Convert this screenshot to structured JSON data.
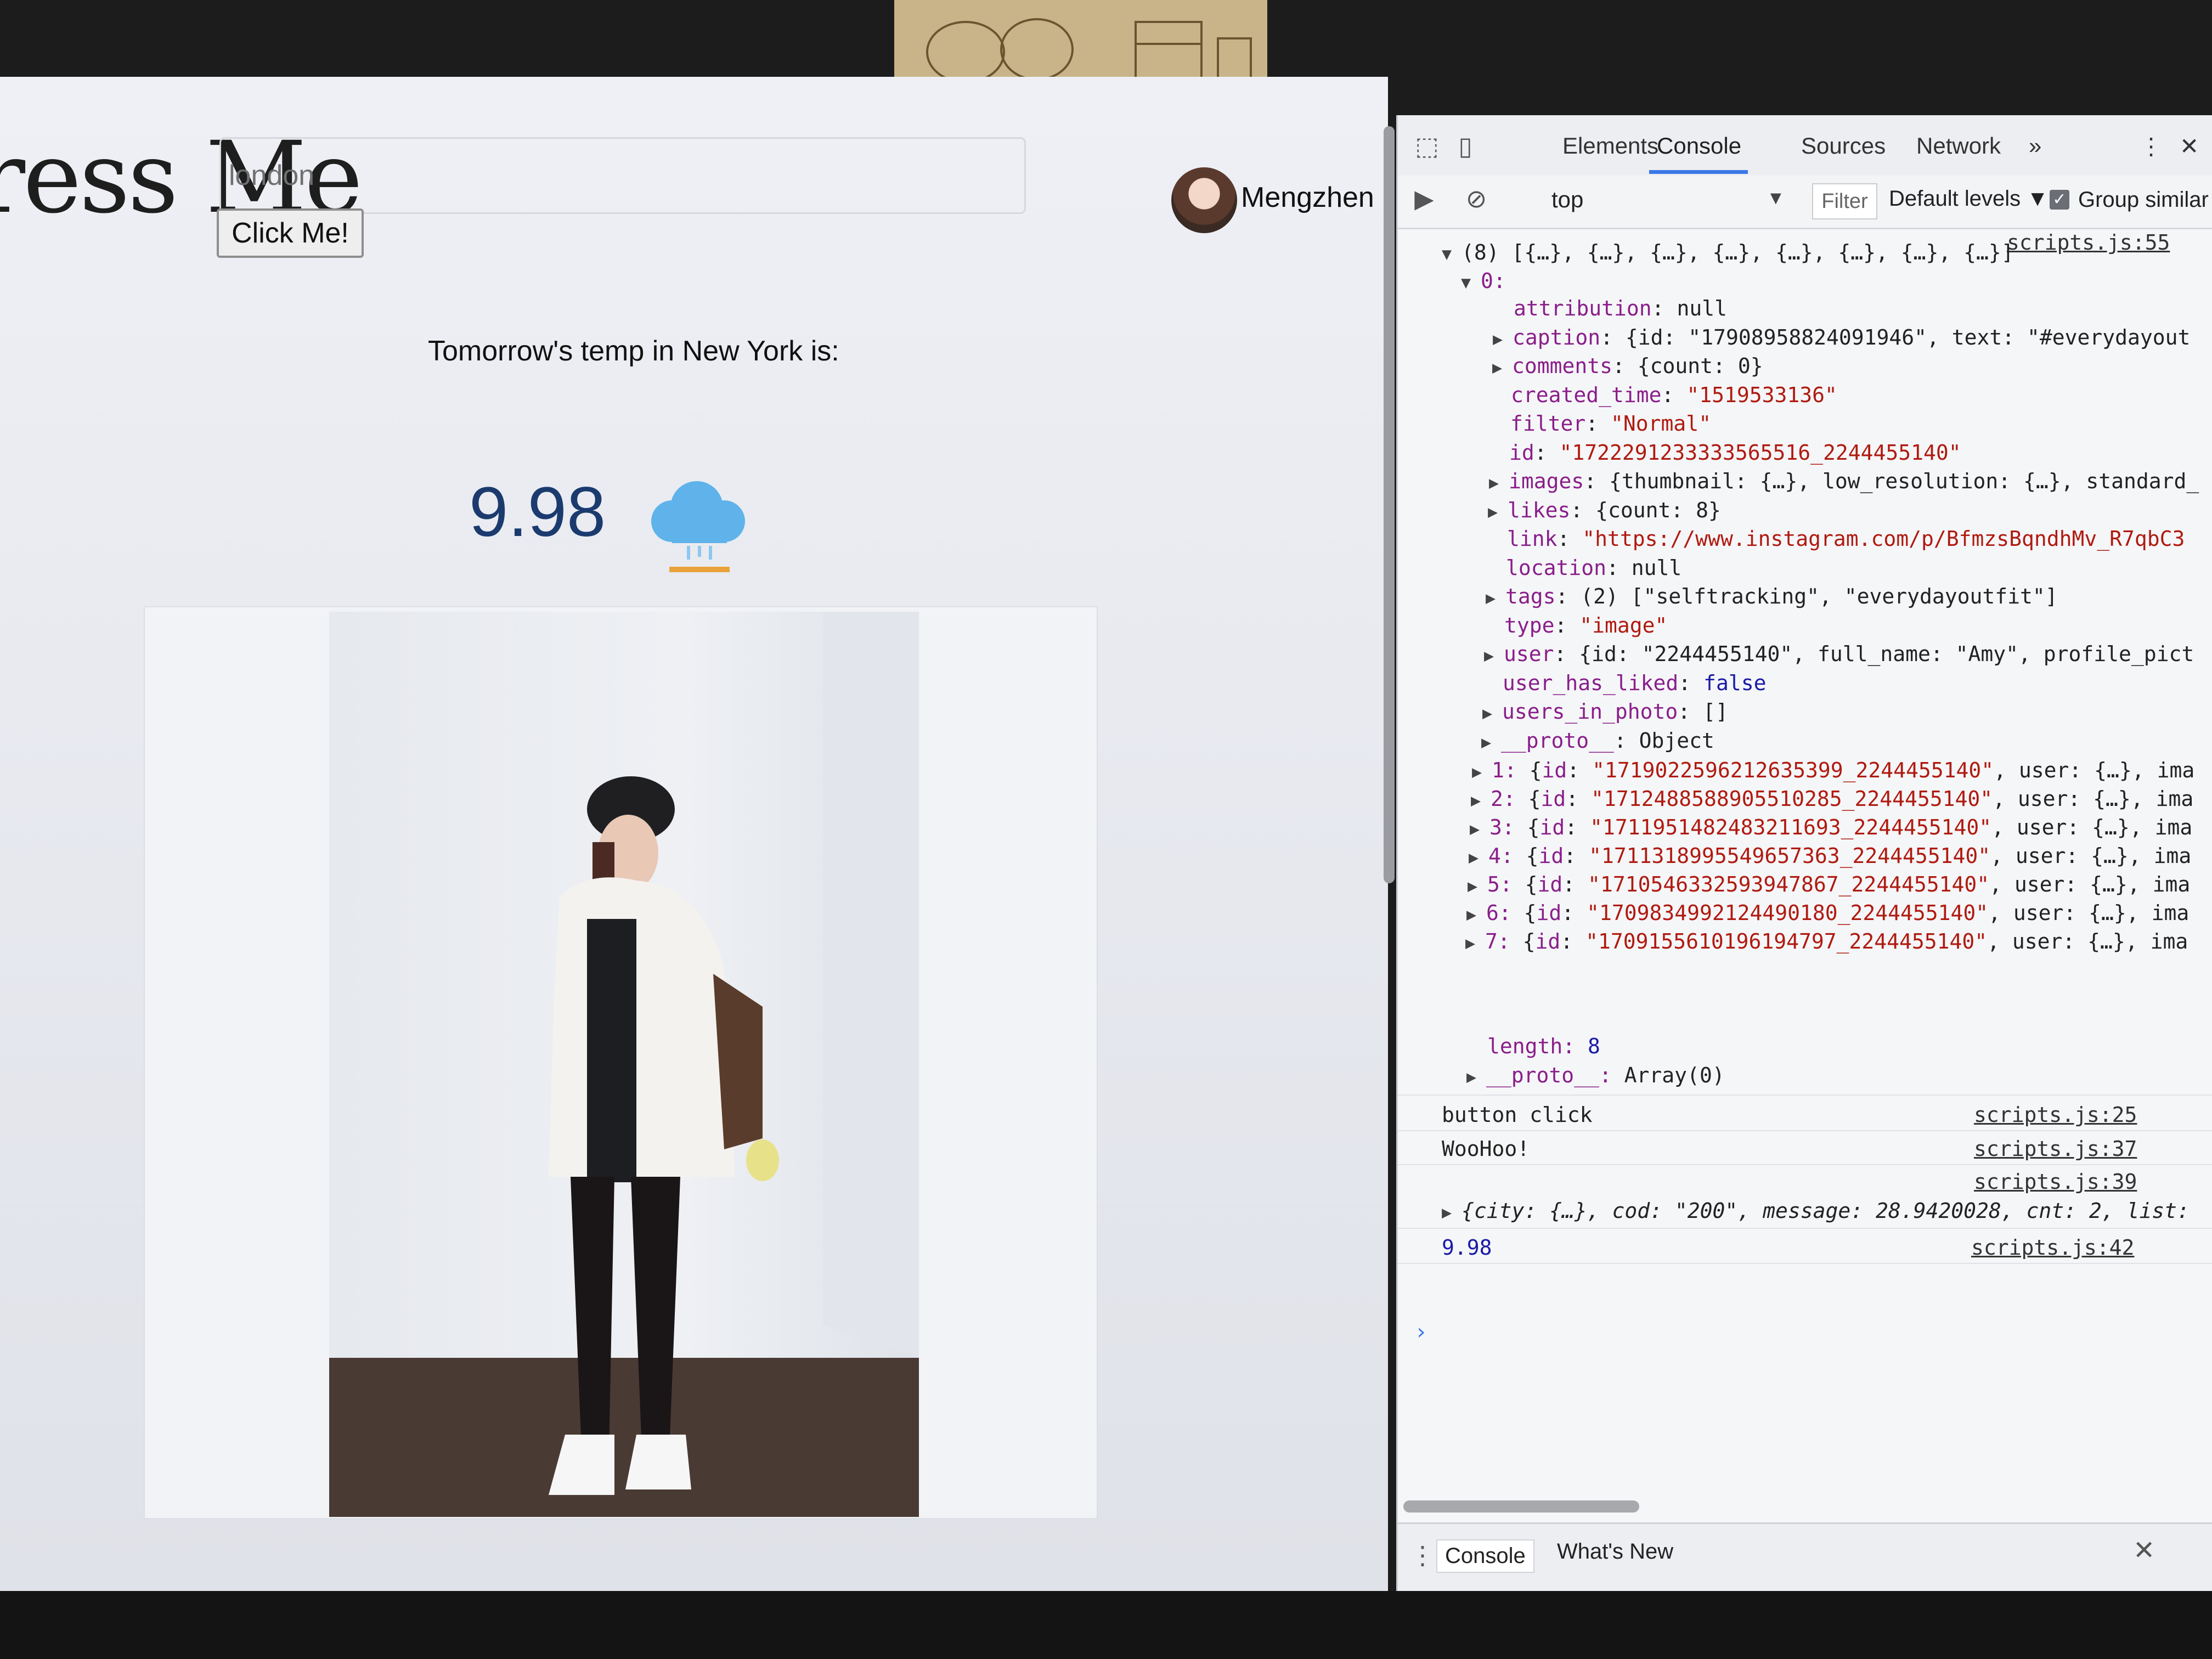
{
  "page": {
    "brand_text": "ress Me",
    "search": {
      "value": "",
      "placeholder": "london"
    },
    "button_label": "Click Me!",
    "user": {
      "name": "Mengzhen"
    },
    "forecast": {
      "caption": "Tomorrow's temp in New York is:",
      "temp": "9.98",
      "icon": "rain-cloud-icon"
    }
  },
  "devtools": {
    "tabs": [
      "Elements",
      "Console",
      "Sources",
      "Network",
      "»"
    ],
    "active_tab": "Console",
    "toolbar": {
      "context": "top",
      "filter_placeholder": "Filter",
      "levels": "Default levels ▼",
      "group_similar": "Group similar",
      "group_similar_checked": true
    },
    "console": {
      "array_header": "(8) [{…}, {…}, {…}, {…}, {…}, {…}, {…}, {…}]",
      "array_source": "scripts.js:55",
      "item0_label": "0:",
      "item0_props": [
        {
          "key": "attribution",
          "value": "null",
          "type": "null",
          "expandable": false
        },
        {
          "key": "caption",
          "value": "{id: \"17908958824091946\", text: \"#everydayout",
          "type": "obj",
          "expandable": true
        },
        {
          "key": "comments",
          "value": "{count: 0}",
          "type": "obj",
          "expandable": true
        },
        {
          "key": "created_time",
          "value": "\"1519533136\"",
          "type": "str",
          "expandable": false
        },
        {
          "key": "filter",
          "value": "\"Normal\"",
          "type": "str",
          "expandable": false
        },
        {
          "key": "id",
          "value": "\"1722291233333565516_2244455140\"",
          "type": "str",
          "expandable": false
        },
        {
          "key": "images",
          "value": "{thumbnail: {…}, low_resolution: {…}, standard_",
          "type": "obj",
          "expandable": true
        },
        {
          "key": "likes",
          "value": "{count: 8}",
          "type": "obj",
          "expandable": true
        },
        {
          "key": "link",
          "value": "\"https://www.instagram.com/p/BfmzsBqndhMv_R7qbC3",
          "type": "str",
          "expandable": false
        },
        {
          "key": "location",
          "value": "null",
          "type": "null",
          "expandable": false
        },
        {
          "key": "tags",
          "value": "(2) [\"selftracking\", \"everydayoutfit\"]",
          "type": "obj",
          "expandable": true
        },
        {
          "key": "type",
          "value": "\"image\"",
          "type": "str",
          "expandable": false
        },
        {
          "key": "user",
          "value": "{id: \"2244455140\", full_name: \"Amy\", profile_pict",
          "type": "obj",
          "expandable": true
        },
        {
          "key": "user_has_liked",
          "value": "false",
          "type": "num",
          "expandable": false
        },
        {
          "key": "users_in_photo",
          "value": "[]",
          "type": "obj",
          "expandable": true
        },
        {
          "key": "__proto__",
          "value": "Object",
          "type": "obj",
          "expandable": true
        }
      ],
      "items": [
        {
          "index": "1:",
          "id": "\"1719022596212635399_2244455140\"",
          "rest": ", user: {…}, ima"
        },
        {
          "index": "2:",
          "id": "\"1712488588905510285_2244455140\"",
          "rest": ", user: {…}, ima"
        },
        {
          "index": "3:",
          "id": "\"1711951482483211693_2244455140\"",
          "rest": ", user: {…}, ima"
        },
        {
          "index": "4:",
          "id": "\"1711318995549657363_2244455140\"",
          "rest": ", user: {…}, ima"
        },
        {
          "index": "5:",
          "id": "\"1710546332593947867_2244455140\"",
          "rest": ", user: {…}, ima"
        },
        {
          "index": "6:",
          "id": "\"1709834992124490180_2244455140\"",
          "rest": ", user: {…}, ima"
        },
        {
          "index": "7:",
          "id": "\"1709155610196194797_2244455140\"",
          "rest": ", user: {…}, ima"
        }
      ],
      "length_key": "length:",
      "length_val": "8",
      "proto_key": "__proto__:",
      "proto_val": "Array(0)",
      "messages": [
        {
          "text": "button click",
          "source": "scripts.js:25"
        },
        {
          "text": "WooHoo!",
          "source": "scripts.js:37"
        }
      ],
      "obj_source": "scripts.js:39",
      "obj_text": "{city: {…}, cod: \"200\", message: 28.9420028, cnt: 2, list:",
      "num_value": "9.98",
      "num_source": "scripts.js:42",
      "prompt": "›"
    },
    "drawer": {
      "tabs": [
        "Console",
        "What's New"
      ],
      "close": "✕"
    }
  }
}
